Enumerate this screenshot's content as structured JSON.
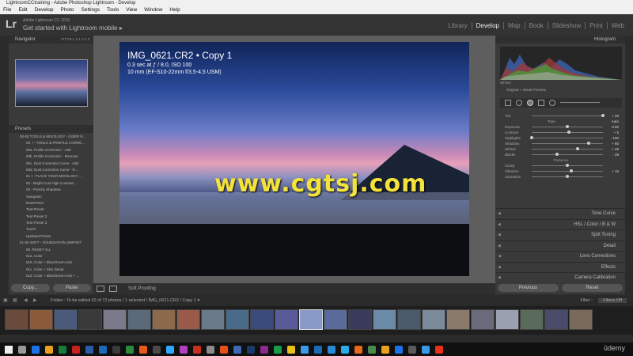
{
  "window": {
    "title": "LightroomCCtraining - Adobe Photoshop Lightroom - Develop"
  },
  "menu": [
    "File",
    "Edit",
    "Develop",
    "Photo",
    "Settings",
    "Tools",
    "View",
    "Window",
    "Help"
  ],
  "identity": {
    "logo": "Lr",
    "small": "Adobe Lightroom CC 2015",
    "main": "Get started with Lightroom mobile ▸"
  },
  "modules": [
    "Library",
    "Develop",
    "Map",
    "Book",
    "Slideshow",
    "Print",
    "Web"
  ],
  "active_module": "Develop",
  "navigator": {
    "title": "Navigator",
    "zoom_options": "FIT  FILL  1:1  1:2 ⇕"
  },
  "presets": {
    "title": "Presets",
    "items": [
      "00-00 TOOLS & MIXOLOGY - (USER R...",
      "00. +- TOOLS & PROFILE CORRE...",
      "00a. Profile Correction - Add",
      "00b. Profile Correction - Remove",
      "00c. Dust Correction Curve - Add",
      "00d. Dust Correction Curve - R...",
      "01 +- PLACE YOUR MIXOLOGY ...",
      "02 - Bright Cool High Contrast ...",
      "03 - Punchy Shadows",
      "Gangnam",
      "NewPreset",
      "Test Preset",
      "Test Preset 2",
      "Test Preset 3",
      "Touch",
      "Updated Preset",
      "01-00 SOFT - FOUNDATION (IMPORT",
      "00. RESET ALL",
      "01a. Color",
      "01b. Color + Blue/Green Kick",
      "01c. Color + Skin Desat",
      "01d. Color + Blue/Green Kick + ..."
    ]
  },
  "left_buttons": [
    "Copy...",
    "Paste"
  ],
  "photo": {
    "name": "IMG_0621.CR2 • Copy 1",
    "exposure_line": "0.3 sec at ƒ / 8.0, ISO 100",
    "lens_line": "10 mm (EF-S10-22mm f/3.5-4.5 USM)"
  },
  "watermark": "www.cgtsj.com",
  "toolbar": {
    "softproof": "Soft Proofing"
  },
  "histogram": {
    "title": "Histogram",
    "label": "Whites",
    "original": "Original + Smart Preview"
  },
  "basic": {
    "tint_label": "Tint",
    "tint_value": "+ 26",
    "tone_label": "Tone",
    "auto_label": "Auto",
    "rows": [
      {
        "label": "Exposure",
        "value": "0.00",
        "pos": 0.5
      },
      {
        "label": "Contrast",
        "value": "+ 5",
        "pos": 0.52
      },
      {
        "label": "Highlights",
        "value": "- 100",
        "pos": 0.0
      },
      {
        "label": "Shadows",
        "value": "+ 60",
        "pos": 0.8
      },
      {
        "label": "Whites",
        "value": "+ 28",
        "pos": 0.64
      },
      {
        "label": "Blacks",
        "value": "- 29",
        "pos": 0.36
      }
    ],
    "presence_label": "Presence",
    "presence_rows": [
      {
        "label": "Clarity",
        "value": "",
        "pos": 0.5
      },
      {
        "label": "Vibrance",
        "value": "+ 12",
        "pos": 0.56
      },
      {
        "label": "Saturation",
        "value": "",
        "pos": 0.5
      }
    ]
  },
  "sections": [
    "Tone Curve",
    "HSL / Color / B & W",
    "Split Toning",
    "Detail",
    "Lens Corrections",
    "Effects",
    "Camera Calibration"
  ],
  "right_buttons": [
    "Previous",
    "Reset"
  ],
  "filmstrip": {
    "info": "Folder : To be edited     62 of 72 photos / 1 selected / IMG_0621.CR2 / Copy 1 ▾",
    "filter_label": "Filter :",
    "filter_value": "Filters Off",
    "count": 24,
    "selected_index": 12
  },
  "taskbar": {
    "brand": "ūdemy"
  }
}
